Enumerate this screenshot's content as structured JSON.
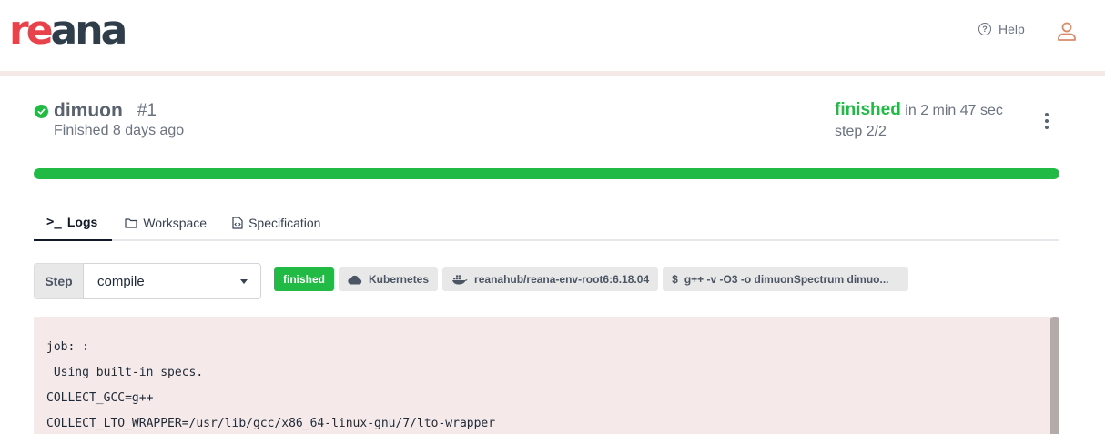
{
  "app": {
    "logo_prefix": "re",
    "logo_suffix": "ana"
  },
  "header": {
    "help_label": "Help",
    "help_icon": "question-circle-icon",
    "user_icon": "user-icon"
  },
  "workflow": {
    "name": "dimuon",
    "run": "#1",
    "subtitle": "Finished 8 days ago",
    "status": "finished",
    "duration": "in 2 min 47 sec",
    "step": "step 2/2",
    "progress_fraction": 1.0
  },
  "tabs": [
    {
      "label": "Logs",
      "icon": "terminal-icon",
      "active": true
    },
    {
      "label": "Workspace",
      "icon": "folder-icon",
      "active": false
    },
    {
      "label": "Specification",
      "icon": "file-code-icon",
      "active": false
    }
  ],
  "step_selector": {
    "label": "Step",
    "value": "compile"
  },
  "badges": {
    "status": "finished",
    "backend": "Kubernetes",
    "image": "reanahub/reana-env-root6:6.18.04",
    "command": "g++ -v -O3 -o dimuonSpectrum dimuo..."
  },
  "log_lines": [
    "job: :",
    " Using built-in specs.",
    "COLLECT_GCC=g++",
    "COLLECT_LTO_WRAPPER=/usr/lib/gcc/x86_64-linux-gnu/7/lto-wrapper"
  ],
  "colors": {
    "success": "#21ba45",
    "brand_red": "#e8424b",
    "brand_dark": "#2f3c4a",
    "log_bg": "#f5eae9"
  }
}
